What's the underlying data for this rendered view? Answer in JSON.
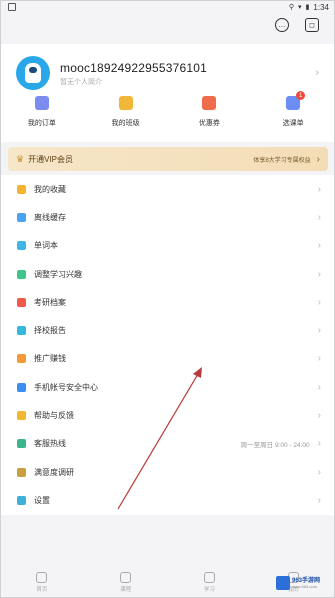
{
  "status_bar": {
    "time": "1:34"
  },
  "profile": {
    "username": "mooc18924922955376101",
    "subtitle": "暂无个人简介"
  },
  "quick_actions": [
    {
      "label": "我的订单",
      "icon": "orders-icon",
      "color": "#7b8cf0",
      "badge": ""
    },
    {
      "label": "我的班级",
      "icon": "class-icon",
      "color": "#f2b739",
      "badge": ""
    },
    {
      "label": "优惠券",
      "icon": "coupon-icon",
      "color": "#f06b4a",
      "badge": ""
    },
    {
      "label": "选课单",
      "icon": "course-list-icon",
      "color": "#6c8df5",
      "badge": "1"
    }
  ],
  "vip": {
    "title": "开通VIP会员",
    "slogan": "体享8大学习专属权益"
  },
  "menu": [
    {
      "label": "我的收藏",
      "icon": "star-icon",
      "color": "#f5b430",
      "extra": ""
    },
    {
      "label": "离线缓存",
      "icon": "download-icon",
      "color": "#4aa3f0",
      "extra": ""
    },
    {
      "label": "单词本",
      "icon": "wordbook-icon",
      "color": "#3fb5e8",
      "extra": ""
    },
    {
      "label": "调整学习兴趣",
      "icon": "interest-icon",
      "color": "#3fc58a",
      "extra": ""
    },
    {
      "label": "考研档案",
      "icon": "archive-icon",
      "color": "#f05a4a",
      "extra": ""
    },
    {
      "label": "择校报告",
      "icon": "report-icon",
      "color": "#35b8e0",
      "extra": ""
    },
    {
      "label": "推广赚钱",
      "icon": "promote-icon",
      "color": "#f29a38",
      "extra": ""
    },
    {
      "label": "手机帐号安全中心",
      "icon": "shield-icon",
      "color": "#3a8ef0",
      "extra": ""
    },
    {
      "label": "帮助与反馈",
      "icon": "help-icon",
      "color": "#f2b730",
      "extra": ""
    },
    {
      "label": "客服热线",
      "icon": "headset-icon",
      "color": "#3bb58a",
      "extra": "周一至周日 9:00 - 24:00"
    },
    {
      "label": "满意度调研",
      "icon": "survey-icon",
      "color": "#c8a040",
      "extra": ""
    },
    {
      "label": "设置",
      "icon": "gear-icon",
      "color": "#3fb0d8",
      "extra": ""
    }
  ],
  "bottom_tabs": [
    {
      "label": "首页",
      "icon": "home-icon"
    },
    {
      "label": "课程",
      "icon": "course-icon"
    },
    {
      "label": "学习",
      "icon": "study-icon"
    },
    {
      "label": "我的",
      "icon": "profile-icon"
    }
  ],
  "watermark": {
    "title": "963手游网",
    "sub": "www.963.com"
  }
}
